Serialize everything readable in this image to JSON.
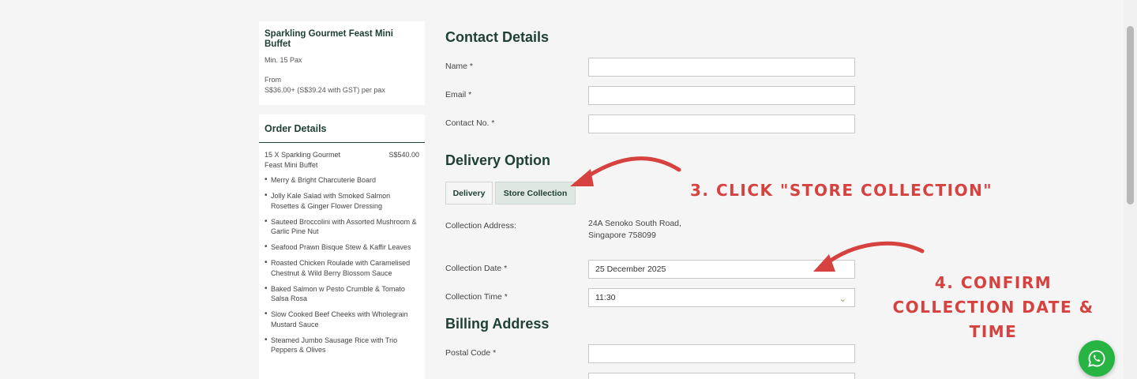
{
  "product": {
    "name": "Sparkling Gourmet Feast Mini Buffet",
    "min_pax": "Min. 15 Pax",
    "from_label": "From",
    "price": "S$36.00+ (S$39.24 with GST) per pax"
  },
  "order": {
    "title": "Order Details",
    "line_item": "15 X Sparkling Gourmet Feast Mini Buffet",
    "line_total": "S$540.00",
    "items": [
      "Merry & Bright Charcuterie Board",
      "Jolly Kale Salad with Smoked Salmon Rosettes & Ginger Flower Dressing",
      "Sauteed Broccolini with Assorted Mushroom & Garlic Pine Nut",
      "Seafood Prawn Bisque Stew & Kaffir Leaves",
      "Roasted Chicken Roulade with Caramelised Chestnut & Wild Berry Blossom Sauce",
      "Baked Salmon w Pesto Crumble & Tomato Salsa Rosa",
      "Slow Cooked Beef Cheeks with Wholegrain Mustard Sauce",
      "Steamed Jumbo Sausage Rice with Trio Peppers & Olives"
    ]
  },
  "contact": {
    "title": "Contact Details",
    "name_label": "Name *",
    "email_label": "Email *",
    "contact_label": "Contact No. *"
  },
  "delivery": {
    "title": "Delivery Option",
    "tab_delivery": "Delivery",
    "tab_store": "Store Collection",
    "address_label": "Collection Address:",
    "address_line1": "24A Senoko South Road,",
    "address_line2": "Singapore 758099",
    "date_label": "Collection Date *",
    "date_value": "25 December 2025",
    "time_label": "Collection Time *",
    "time_value": "11:30"
  },
  "billing": {
    "title": "Billing Address",
    "postal_label": "Postal Code *"
  },
  "annotations": {
    "step3": "3. CLICK \"STORE COLLECTION\"",
    "step4": "4. CONFIRM COLLECTION DATE & TIME"
  },
  "colors": {
    "brand": "#1f4034",
    "annotation": "#d6423f",
    "whatsapp": "#27b443"
  }
}
